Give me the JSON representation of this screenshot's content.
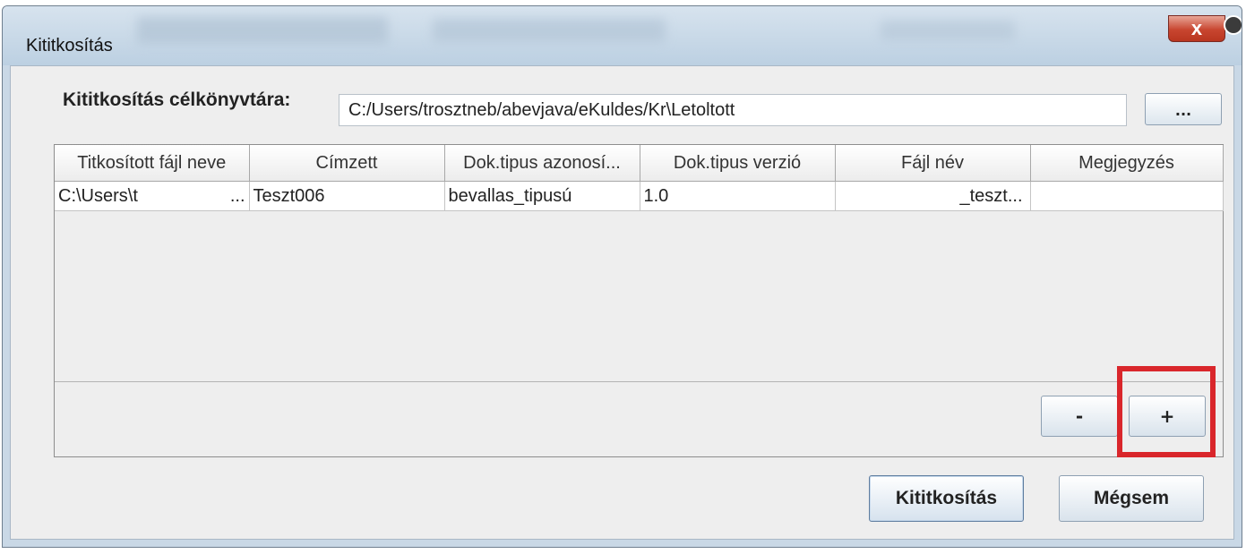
{
  "window": {
    "title": "Kititkosítás",
    "close_label": "x"
  },
  "target": {
    "label": "Kititkosítás célkönyvtára:",
    "path_value": "C:/Users/trosztneb/abevjava/eKuldes/Kr\\Letoltott",
    "browse_label": "..."
  },
  "table": {
    "columns": [
      "Titkosított fájl neve",
      "Címzett",
      "Dok.tipus azonosí...",
      "Dok.tipus verzió",
      "Fájl név",
      "Megjegyzés"
    ],
    "rows": [
      {
        "file_name": "C:\\Users\\t",
        "file_name_ellipsis": "...",
        "recipient": "Teszt006",
        "doc_type_id": "bevallas_tipusú",
        "doc_type_version": "1.0",
        "file": "_teszt...",
        "note": ""
      }
    ]
  },
  "buttons": {
    "remove": "-",
    "add": "+",
    "decrypt": "Kititkosítás",
    "cancel": "Mégsem"
  },
  "colors": {
    "highlight": "#d9262b",
    "close_button": "#c8452f",
    "window_frame": "#c9d8e6"
  }
}
